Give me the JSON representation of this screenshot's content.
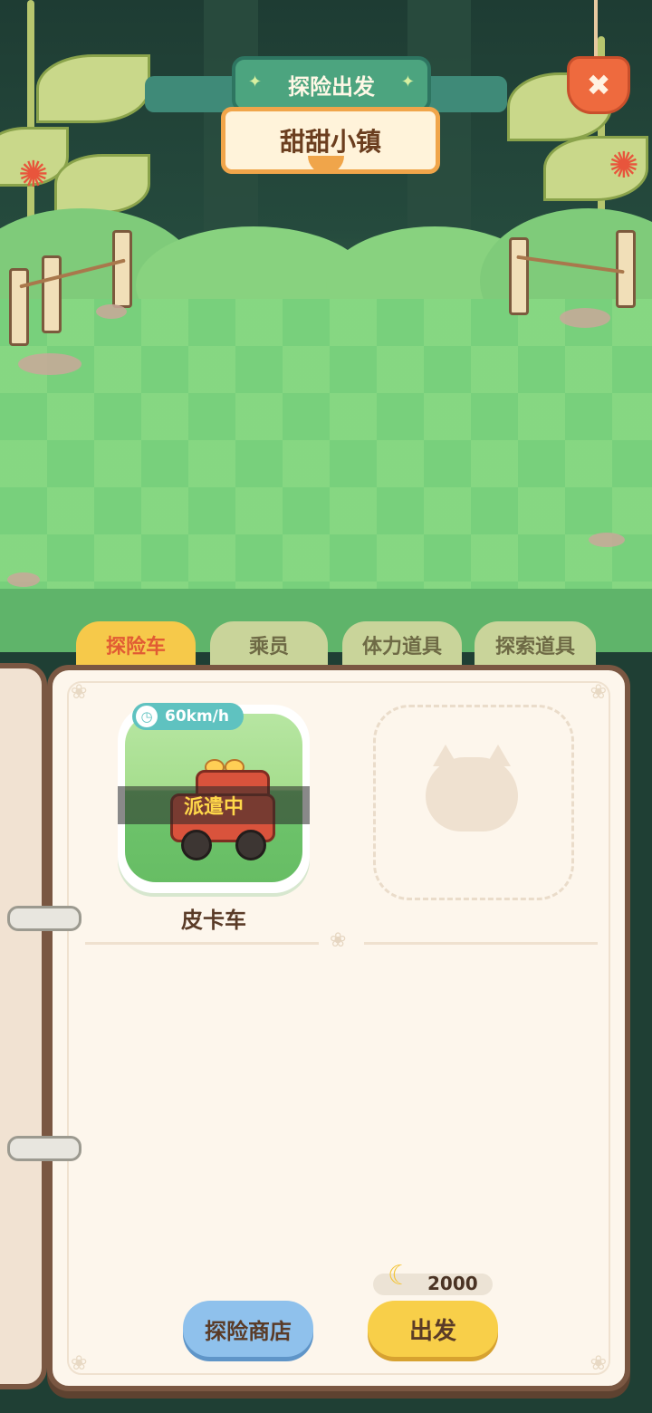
{
  "banner": {
    "title": "探险出发",
    "destination": "甜甜小镇"
  },
  "close_button": {
    "icon": "close-icon",
    "glyph": "✖"
  },
  "tabs": [
    {
      "label": "探险车",
      "active": true
    },
    {
      "label": "乘员",
      "active": false
    },
    {
      "label": "体力道具",
      "active": false
    },
    {
      "label": "探索道具",
      "active": false
    }
  ],
  "vehicle": {
    "name": "皮卡车",
    "speed": "60km/h",
    "status": "派遣中",
    "icon": "pickup-truck-icon"
  },
  "empty_slot": {
    "icon": "cat-placeholder-icon"
  },
  "footer": {
    "shop_label": "探险商店",
    "go_label": "出发",
    "cost": "2000",
    "cost_icon": "banana-icon"
  },
  "colors": {
    "active_tab": "#f6c94a",
    "inactive_tab": "#c9d49a",
    "speed_badge": "#5fc2c0",
    "go_button": "#f8cf49",
    "shop_button": "#8fc1ec"
  }
}
